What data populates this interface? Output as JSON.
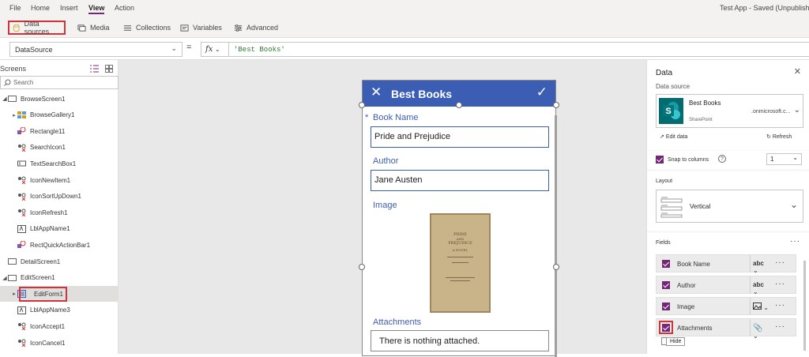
{
  "menu": {
    "items": [
      "File",
      "Home",
      "Insert",
      "View",
      "Action"
    ],
    "active": "View",
    "app_title": "Test App - Saved (Unpublish"
  },
  "ribbon": {
    "data_sources": "Data sources",
    "media": "Media",
    "collections": "Collections",
    "variables": "Variables",
    "advanced": "Advanced"
  },
  "formula_bar": {
    "property": "DataSource",
    "equals": "=",
    "fx": "fx",
    "formula": "'Best Books'"
  },
  "tree_view": {
    "header": "Screens",
    "search_placeholder": "Search",
    "items": [
      {
        "label": "BrowseScreen1",
        "type": "screen"
      },
      {
        "label": "BrowseGallery1",
        "type": "gallery"
      },
      {
        "label": "Rectangle11",
        "type": "shape"
      },
      {
        "label": "SearchIcon1",
        "type": "icon"
      },
      {
        "label": "TextSearchBox1",
        "type": "textinput"
      },
      {
        "label": "IconNewItem1",
        "type": "icon"
      },
      {
        "label": "IconSortUpDown1",
        "type": "icon"
      },
      {
        "label": "IconRefresh1",
        "type": "icon"
      },
      {
        "label": "LblAppName1",
        "type": "label"
      },
      {
        "label": "RectQuickActionBar1",
        "type": "shape"
      },
      {
        "label": "DetailScreen1",
        "type": "screen"
      },
      {
        "label": "EditScreen1",
        "type": "screen"
      },
      {
        "label": "EditForm1",
        "type": "form"
      },
      {
        "label": "LblAppName3",
        "type": "label"
      },
      {
        "label": "IconAccept1",
        "type": "icon"
      },
      {
        "label": "IconCancel1",
        "type": "icon"
      }
    ]
  },
  "form": {
    "title": "Best Books",
    "fields": [
      {
        "label": "Book Name",
        "required": "*",
        "value": "Pride and Prejudice"
      },
      {
        "label": "Author",
        "value": "Jane Austen"
      },
      {
        "label": "Image"
      },
      {
        "label": "Attachments",
        "value": "There is nothing attached."
      }
    ],
    "book_cover_lines": [
      "PRIDE",
      "AND",
      "PREJUDICE",
      "A NOVEL"
    ]
  },
  "data_panel": {
    "title": "Data",
    "data_source_label": "Data source",
    "source_name": "Best Books",
    "source_url": ".onmicrosoft.c...",
    "source_type": "SharePoint",
    "edit_data": "Edit data",
    "refresh": "Refresh",
    "snap_to_columns": "Snap to columns",
    "columns_value": "1",
    "layout_label": "Layout",
    "layout_value": "Vertical",
    "fields_label": "Fields",
    "fields": [
      {
        "name": "Book Name",
        "type": "abc"
      },
      {
        "name": "Author",
        "type": "abc"
      },
      {
        "name": "Image",
        "type": ""
      },
      {
        "name": "Attachments",
        "type": ""
      }
    ],
    "tooltip": "Hide"
  },
  "colors": {
    "accent": "#742774",
    "form_header": "#3b5eb4",
    "highlight": "#d13438"
  }
}
